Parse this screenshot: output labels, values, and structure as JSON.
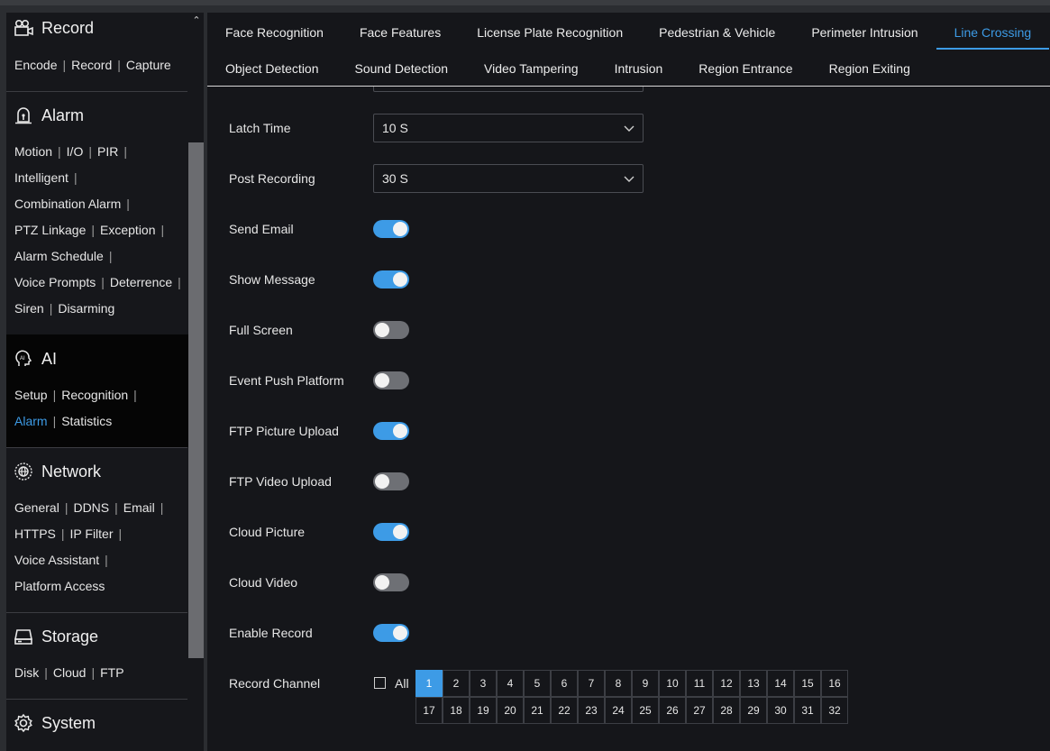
{
  "sidebar": {
    "sections": [
      {
        "title": "Record",
        "icon": "camera-record-icon",
        "links": [
          [
            "Encode",
            "Record",
            "Capture"
          ]
        ]
      },
      {
        "title": "Alarm",
        "icon": "alarm-icon",
        "links": [
          [
            "Motion",
            "I/O",
            "PIR"
          ],
          [
            "Intelligent"
          ],
          [
            "Combination Alarm"
          ],
          [
            "PTZ Linkage",
            "Exception"
          ],
          [
            "Alarm Schedule"
          ],
          [
            "Voice Prompts",
            "Deterrence"
          ],
          [
            "Siren",
            "Disarming"
          ]
        ]
      },
      {
        "title": "AI",
        "icon": "ai-head-icon",
        "links": [
          [
            "Setup",
            "Recognition"
          ],
          [
            "Alarm",
            "Statistics"
          ]
        ],
        "active_link": "Alarm"
      },
      {
        "title": "Network",
        "icon": "network-globe-icon",
        "links": [
          [
            "General",
            "DDNS",
            "Email"
          ],
          [
            "HTTPS",
            "IP Filter"
          ],
          [
            "Voice Assistant"
          ],
          [
            "Platform Access"
          ]
        ]
      },
      {
        "title": "Storage",
        "icon": "hard-drive-icon",
        "links": [
          [
            "Disk",
            "Cloud",
            "FTP"
          ]
        ]
      },
      {
        "title": "System",
        "icon": "gear-icon",
        "links": []
      }
    ]
  },
  "tabs": {
    "row1": [
      "Face Recognition",
      "Face Features",
      "License Plate Recognition",
      "Pedestrian & Vehicle",
      "Perimeter Intrusion",
      "Line Crossing"
    ],
    "row2": [
      "Object Detection",
      "Sound Detection",
      "Video Tampering",
      "Intrusion",
      "Region Entrance",
      "Region Exiting"
    ],
    "active": "Line Crossing"
  },
  "form": {
    "latch_time": {
      "label": "Latch Time",
      "value": "10 S"
    },
    "post_recording": {
      "label": "Post Recording",
      "value": "30 S"
    },
    "toggles": [
      {
        "label": "Send Email",
        "on": true
      },
      {
        "label": "Show Message",
        "on": true
      },
      {
        "label": "Full Screen",
        "on": false
      },
      {
        "label": "Event Push Platform",
        "on": false
      },
      {
        "label": "FTP Picture Upload",
        "on": true
      },
      {
        "label": "FTP Video Upload",
        "on": false
      },
      {
        "label": "Cloud Picture",
        "on": true
      },
      {
        "label": "Cloud Video",
        "on": false
      },
      {
        "label": "Enable Record",
        "on": true
      }
    ],
    "record_channel": {
      "label": "Record Channel",
      "all_label": "All",
      "all_checked": false,
      "channels": [
        "1",
        "2",
        "3",
        "4",
        "5",
        "6",
        "7",
        "8",
        "9",
        "10",
        "11",
        "12",
        "13",
        "14",
        "15",
        "16",
        "17",
        "18",
        "19",
        "20",
        "21",
        "22",
        "23",
        "24",
        "25",
        "26",
        "27",
        "28",
        "29",
        "30",
        "31",
        "32"
      ],
      "selected": [
        "1"
      ]
    }
  },
  "colors": {
    "accent": "#3d9be6",
    "toggle_off": "#6e7075",
    "sidebar_bg": "#16171b",
    "main_bg": "#15161a"
  }
}
